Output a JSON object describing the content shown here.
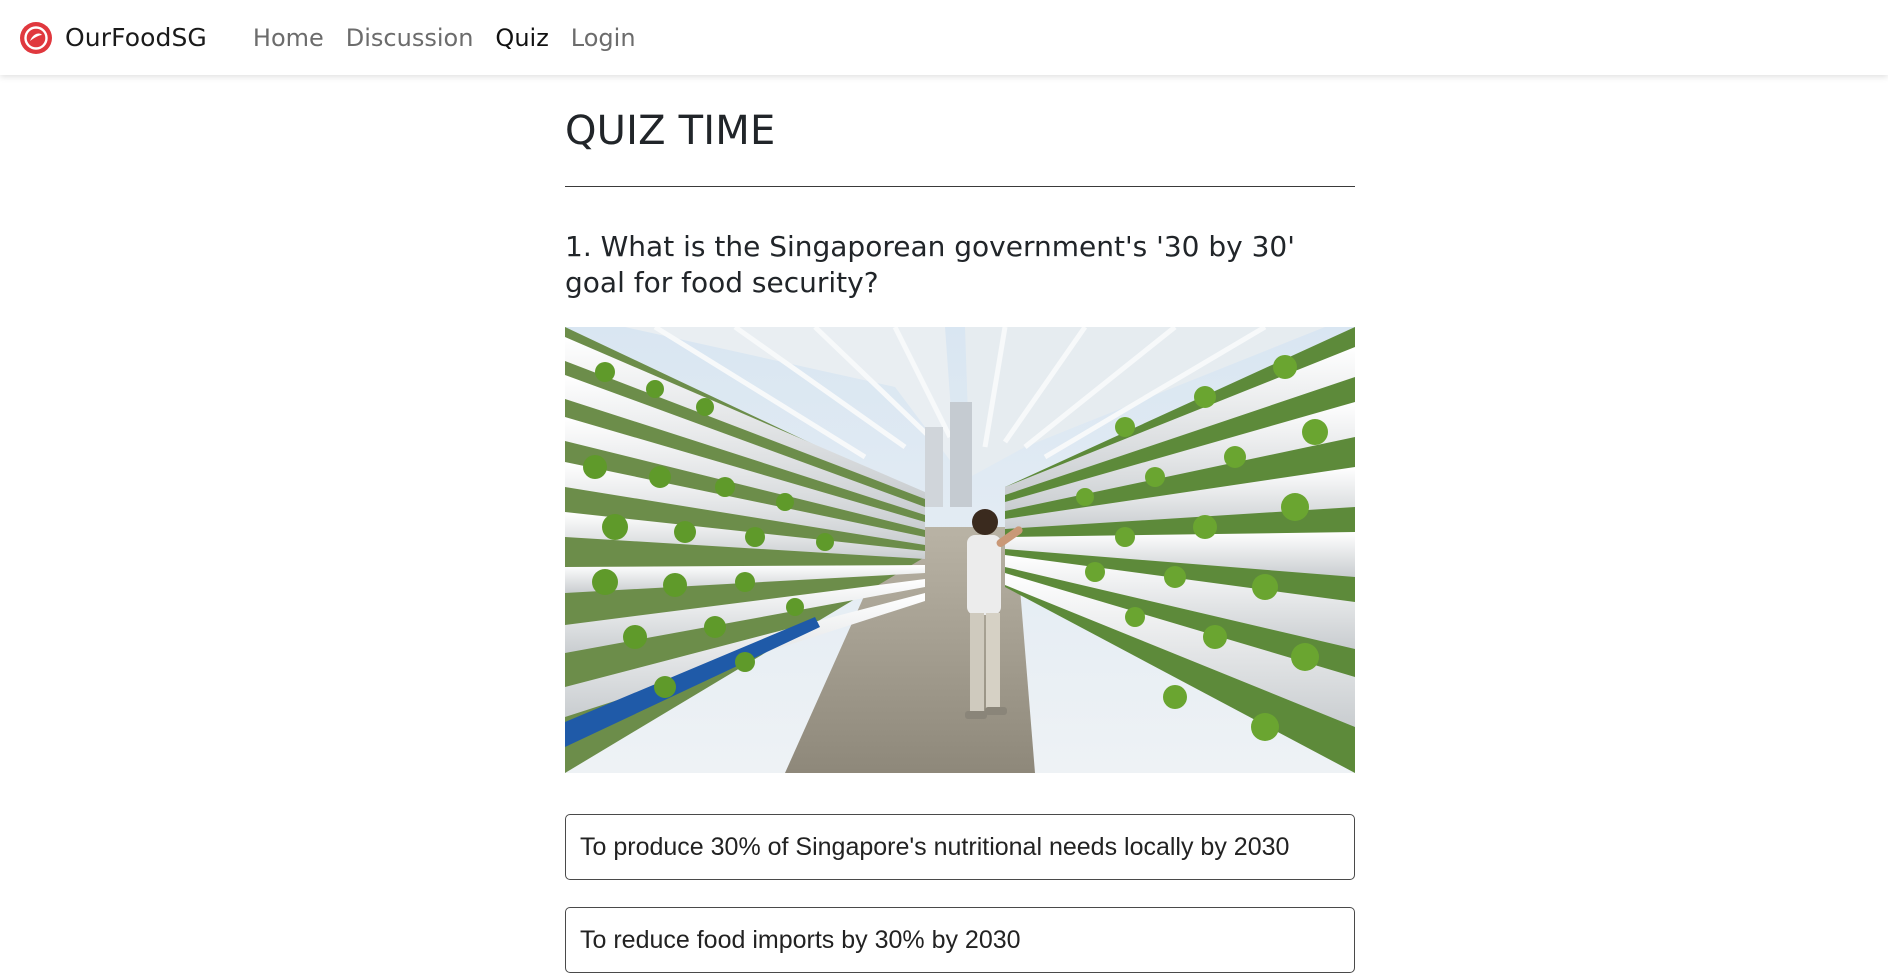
{
  "brand": {
    "name": "OurFoodSG",
    "logo_icon": "ourfoodsg-logo-icon",
    "accent_color": "#e0383e"
  },
  "nav": {
    "items": [
      {
        "label": "Home",
        "active": false
      },
      {
        "label": "Discussion",
        "active": false
      },
      {
        "label": "Quiz",
        "active": true
      },
      {
        "label": "Login",
        "active": false
      }
    ]
  },
  "main": {
    "title": "QUIZ TIME",
    "question": "1. What is the Singaporean government's '30 by 30' goal for food security?",
    "image_alt": "vertical-farm-photo",
    "options": [
      {
        "label": "To produce 30% of Singapore's nutritional needs locally by 2030"
      },
      {
        "label": "To reduce food imports by 30% by 2030"
      }
    ]
  }
}
